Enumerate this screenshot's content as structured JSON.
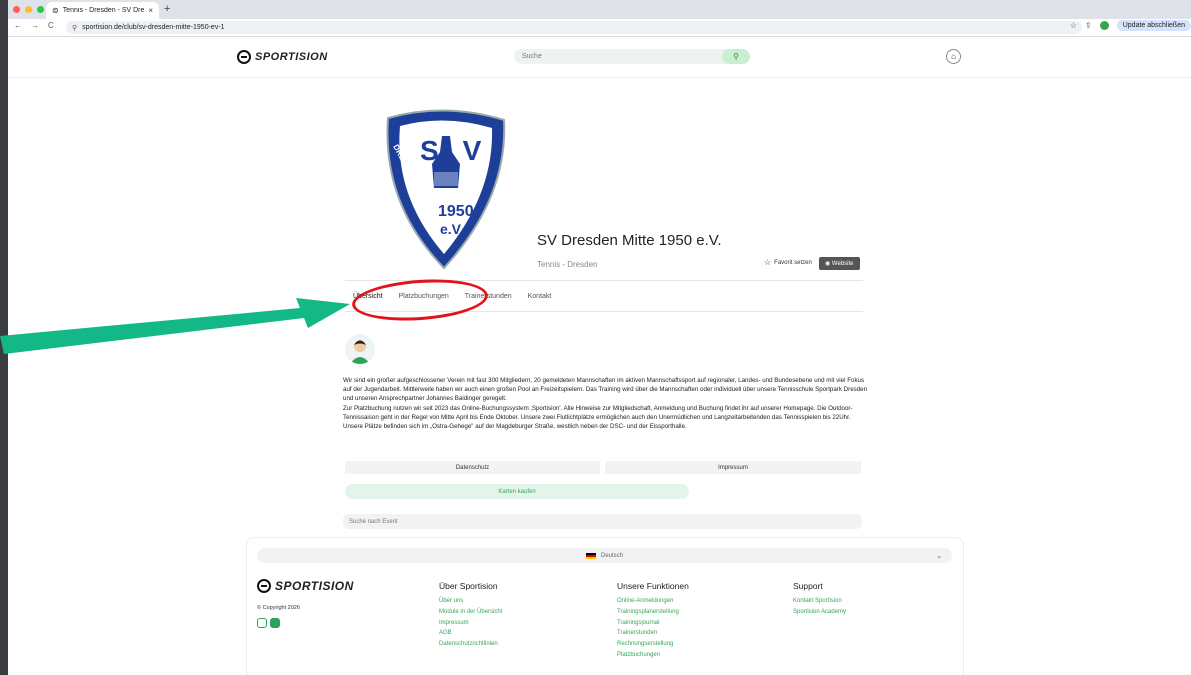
{
  "browser": {
    "tab_title": "Tennis - Dresden - SV Dresde",
    "tab_close": "×",
    "new_tab": "+",
    "url": "sportision.de/club/sv-dresden-mitte-1950-ev-1",
    "update_label": "Update abschließen",
    "colors": {
      "red": "#ff5f57",
      "yellow": "#febc2e",
      "green": "#28c840"
    }
  },
  "header": {
    "brand": "SPORTISION",
    "search_placeholder": "Suche"
  },
  "club": {
    "crest_letters": "SV",
    "crest_year": "1950",
    "crest_ev": "e.V.",
    "crest_ring_text": "DRESDEN MITTE",
    "name": "SV Dresden Mitte 1950 e.V.",
    "subtitle": "Tennis - Dresden",
    "favorite_label": "Favorit setzen",
    "website_label": "Website"
  },
  "tabs": [
    {
      "label": "Übersicht"
    },
    {
      "label": "Platzbuchungen"
    },
    {
      "label": "Trainerstunden"
    },
    {
      "label": "Kontakt"
    }
  ],
  "description": [
    "Wir sind ein großer aufgeschlossener Verein mit fast 300 Mitgliedern, 20 gemeldeten Mannschaften im aktiven Mannschaftssport auf regionaler, Landes- und Bundesebene und mit viel Fokus auf der Jugendarbeit. Mittlerweile haben wir auch einen großen Pool an Freizeitspielern. Das Training wird über die Mannschaften oder individuell über unsere Tennisschule Sportpark Dresden und unseren Ansprechpartner Johannes Baidinger geregelt.",
    "Zur Platzbuchung nutzen wir seit 2023 das Online-Buchungssystem ‚Sportision'. Alle Hinweise zur Mitgliedschaft, Anmeldung und Buchung findet ihr auf unserer Homepage. Die Outdoor-Tennissaison geht in der Regel von Mitte April bis Ende Oktober. Unsere zwei Flutlichtplätze ermöglichen auch den Unermüdlichen und Langzeitarbeitenden das Tennisspielen bis 22Uhr.",
    "Unsere Plätze befinden sich im „Ostra-Gehege\" auf der Magdeburger Straße, westlich neben der DSC- und der Eissporthalle."
  ],
  "links": {
    "datenschutz": "Datenschutz",
    "impressum": "Impressum"
  },
  "buy_tickets": "Karten kaufen",
  "event_search_placeholder": "Suche nach Event",
  "footer": {
    "language": "Deutsch",
    "copyright": "© Copyright 2026",
    "columns": [
      {
        "title": "Über Sportision",
        "items": [
          "Über uns",
          "Module in der Übersicht",
          "Impressum",
          "AGB",
          "Datenschutzrichtlinien"
        ]
      },
      {
        "title": "Unsere Funktionen",
        "items": [
          "Online-Anmeldungen",
          "Trainingsplanerstellung",
          "Trainingsjournal",
          "Trainerstunden",
          "Rechnungserstellung",
          "Platzbuchungen"
        ]
      },
      {
        "title": "Support",
        "items": [
          "Kontakt Sportision",
          "Sportision Academy"
        ]
      }
    ]
  },
  "annotation_colors": {
    "ring": "#e0141c",
    "arrow": "#14b886"
  }
}
